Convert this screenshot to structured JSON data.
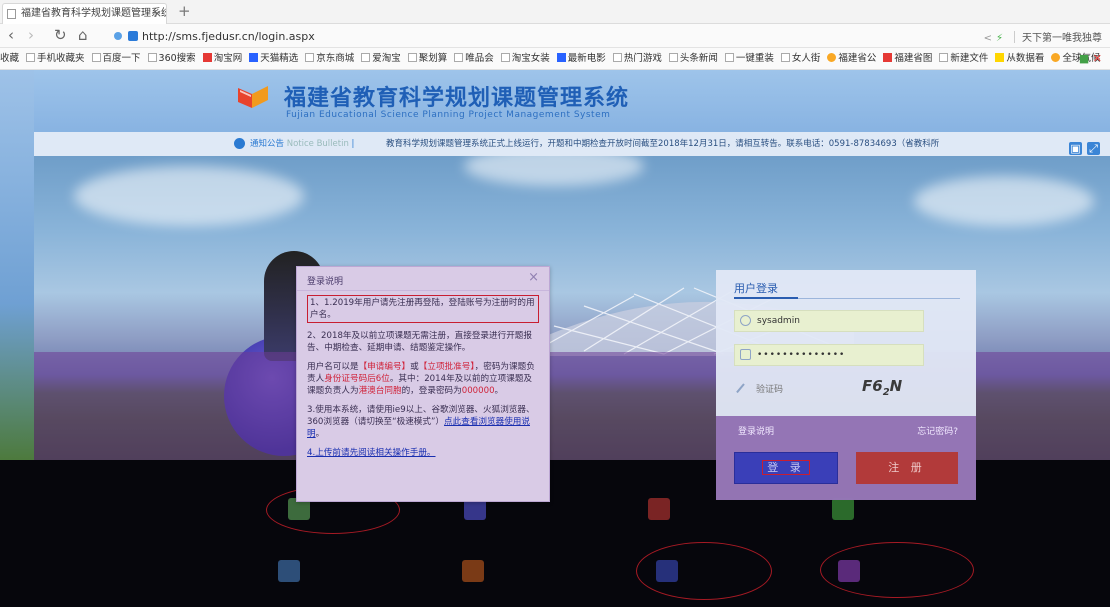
{
  "browser": {
    "tab_title": "福建省教育科学规划课题管理系统",
    "tab_close": "×",
    "new_tab": "+",
    "url": "http://sms.fjedusr.cn/login.aspx",
    "right_text": "天下第一唯我独尊",
    "nav": {
      "back": "‹",
      "forward": "›",
      "reload": "↻",
      "home": "⌂"
    },
    "bookmarks": [
      "收藏",
      "手机收藏夹",
      "百度一下",
      "360搜索",
      "淘宝网",
      "天猫精选",
      "京东商城",
      "爱淘宝",
      "聚划算",
      "唯品会",
      "淘宝女装",
      "最新电影",
      "热门游戏",
      "头条新闻",
      "一键重装",
      "女人街",
      "福建省公",
      "福建省图",
      "新建文件",
      "从数据看",
      "全球气候"
    ],
    "bookmarks_more": "»"
  },
  "header": {
    "title_cn": "福建省教育科学规划课题管理系统",
    "title_en": "Fujian Educational Science Planning Project Management System"
  },
  "notice": {
    "label": "通知公告",
    "label_en": "Notice Bulletin",
    "text": "教育科学规划课题管理系统正式上线运行，开题和中期检查开放时间截至2018年12月31日，请相互转告。联系电话：0591-87834693（省教科所"
  },
  "modal": {
    "title": "登录说明",
    "close": "×",
    "item1": "1、1.2019年用户请先注册再登陆，登陆账号为注册时的用户名。",
    "item2": "2、2018年及以前立项课题无需注册，直接登录进行开题报告、中期检查、延期申请、结题鉴定操作。",
    "item3_a": "用户名可以是",
    "item3_b": "【申请编号】",
    "item3_c": "或",
    "item3_d": "【立项批准号】",
    "item3_e": "，密码为课题负责人",
    "item3_f": "身份证号码后6位",
    "item3_g": "。其中：2014年及以前的立项课题及课题负责人为",
    "item3_h": "港澳台同胞",
    "item3_i": "的，登录密码为",
    "item3_j": "000000",
    "item3_k": "。",
    "item4_a": "3.使用本系统，请使用ie9以上、谷歌浏览器、火狐浏览器、360浏览器（请切换至“极速模式”）",
    "item4_link": "点此查看浏览器使用说明",
    "item4_b": "。",
    "item5": "4.上传前请先阅读相关操作手册。"
  },
  "login": {
    "title": "用户登录",
    "username": "sysadmin",
    "password": "••••••••••••••",
    "captcha_placeholder": "验证码",
    "captcha_code": "F6",
    "captcha_code_sub": "2",
    "captcha_code_end": "N",
    "help": "登录说明",
    "forgot": "忘记密码?",
    "login_button": "登 录",
    "register_button": "注 册"
  },
  "colors": {
    "brand": "#1f5fb6",
    "annotation_red": "#c81e32",
    "register": "#b23a3a",
    "login": "#3a3fb8"
  }
}
